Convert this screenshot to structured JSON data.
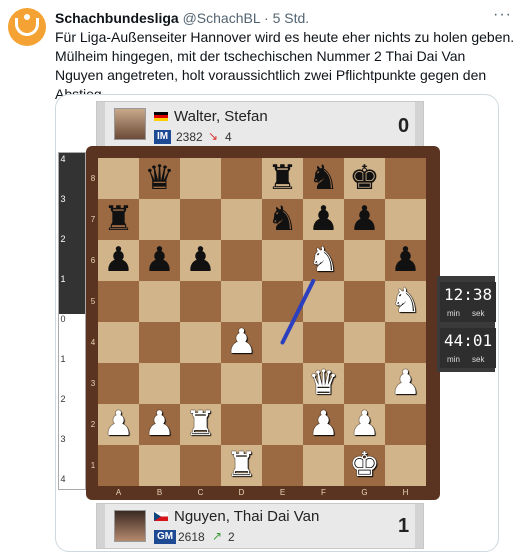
{
  "tweet": {
    "author_name": "Schachbundesliga",
    "author_handle": "@SchachBL",
    "separator": "·",
    "time": "5 Std.",
    "more_label": "···",
    "text": "Für Liga-Außenseiter Hannover wird es heute eher nichts zu holen geben. Mülheim hingegen, mit der tschechischen Nummer 2 Thai Dai Van Nguyen angetreten, holt voraussichtlich zwei Pflichtpunkte gegen den Abstieg."
  },
  "top_player": {
    "name": "Walter, Stefan",
    "title": "IM",
    "rating": "2382",
    "delta_arrow": "↘",
    "delta": "4",
    "score": "0",
    "flag": "de"
  },
  "bottom_player": {
    "name": "Nguyen, Thai Dai Van",
    "title": "GM",
    "rating": "2618",
    "delta_arrow": "↗",
    "delta": "2",
    "score": "1",
    "flag": "cz"
  },
  "clocks": [
    {
      "time": "12:38",
      "unit_min": "min",
      "unit_sec": "sek"
    },
    {
      "time": "44:01",
      "unit_min": "min",
      "unit_sec": "sek"
    }
  ],
  "eval_bar": {
    "white_fraction": 0.52,
    "ticks": [
      "4",
      "3",
      "2",
      "1",
      "0",
      "1",
      "2",
      "3",
      "4"
    ]
  },
  "board": {
    "files": [
      "A",
      "B",
      "C",
      "D",
      "E",
      "F",
      "G",
      "H"
    ],
    "ranks": [
      "8",
      "7",
      "6",
      "5",
      "4",
      "3",
      "2",
      "1"
    ],
    "pieces": [
      {
        "square": "b8",
        "glyph": "♛",
        "color": "b"
      },
      {
        "square": "e8",
        "glyph": "♜",
        "color": "b"
      },
      {
        "square": "f8",
        "glyph": "♞",
        "color": "b"
      },
      {
        "square": "g8",
        "glyph": "♚",
        "color": "b"
      },
      {
        "square": "a7",
        "glyph": "♜",
        "color": "b"
      },
      {
        "square": "e7",
        "glyph": "♞",
        "color": "b"
      },
      {
        "square": "f7",
        "glyph": "♟",
        "color": "b"
      },
      {
        "square": "g7",
        "glyph": "♟",
        "color": "b"
      },
      {
        "square": "a6",
        "glyph": "♟",
        "color": "b"
      },
      {
        "square": "b6",
        "glyph": "♟",
        "color": "b"
      },
      {
        "square": "c6",
        "glyph": "♟",
        "color": "b"
      },
      {
        "square": "f6",
        "glyph": "♞",
        "color": "w"
      },
      {
        "square": "h6",
        "glyph": "♟",
        "color": "b"
      },
      {
        "square": "h5",
        "glyph": "♞",
        "color": "w"
      },
      {
        "square": "d4",
        "glyph": "♟",
        "color": "w"
      },
      {
        "square": "f3",
        "glyph": "♛",
        "color": "w"
      },
      {
        "square": "h3",
        "glyph": "♟",
        "color": "w"
      },
      {
        "square": "a2",
        "glyph": "♟",
        "color": "w"
      },
      {
        "square": "b2",
        "glyph": "♟",
        "color": "w"
      },
      {
        "square": "c2",
        "glyph": "♜",
        "color": "w"
      },
      {
        "square": "f2",
        "glyph": "♟",
        "color": "w"
      },
      {
        "square": "g2",
        "glyph": "♟",
        "color": "w"
      },
      {
        "square": "d1",
        "glyph": "♜",
        "color": "w"
      },
      {
        "square": "g1",
        "glyph": "♚",
        "color": "w"
      }
    ],
    "arrow": {
      "from": "e4",
      "to": "f6",
      "color": "#2b3fbf"
    }
  }
}
